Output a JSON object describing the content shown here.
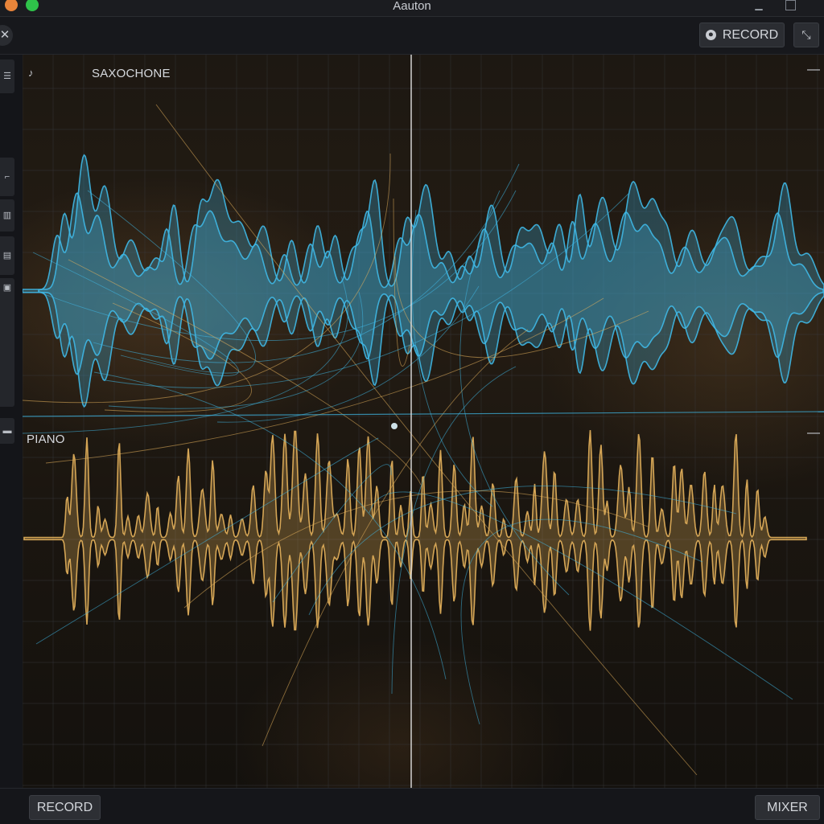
{
  "window": {
    "title": "Aauton"
  },
  "toolbar": {
    "record_label": "RECORD",
    "record_icon": "record-icon",
    "tool_icon": "cursor-tool-icon"
  },
  "tracks": [
    {
      "name": "SAXOCHONE",
      "color": "#3fb8e6",
      "icon": "saxophone-icon"
    },
    {
      "name": "PIANO",
      "color": "#e6b25c"
    }
  ],
  "footer": {
    "record_label": "RECORD",
    "mixer_label": "MIXER"
  },
  "colors": {
    "background": "#101115",
    "panel": "#17181c",
    "grid": "#3a3b40",
    "playhead": "#e6e6e6"
  },
  "glyphs": {
    "close": "✕",
    "minus": "—",
    "sax": "♪",
    "tool": "⤡"
  }
}
